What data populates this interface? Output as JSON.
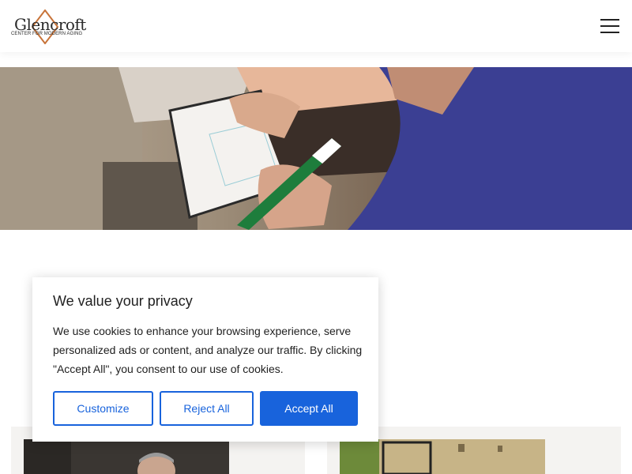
{
  "header": {
    "logo_name": "Glencroft",
    "logo_tagline": "CENTER FOR MODERN AGING",
    "menu_icon": "hamburger-menu-icon"
  },
  "hero": {
    "image": "residents writing on whiteboard with green marker"
  },
  "cookie_banner": {
    "title": "We value your privacy",
    "message": "We use cookies to enhance your browsing experience, serve personalized ads or content, and analyze our traffic. By clicking \"Accept All\", you consent to our use of cookies.",
    "customize_label": "Customize",
    "reject_label": "Reject All",
    "accept_label": "Accept All"
  },
  "colors": {
    "accent": "#1863dc",
    "logo_diamond": "#c8743a",
    "text": "#212121"
  }
}
